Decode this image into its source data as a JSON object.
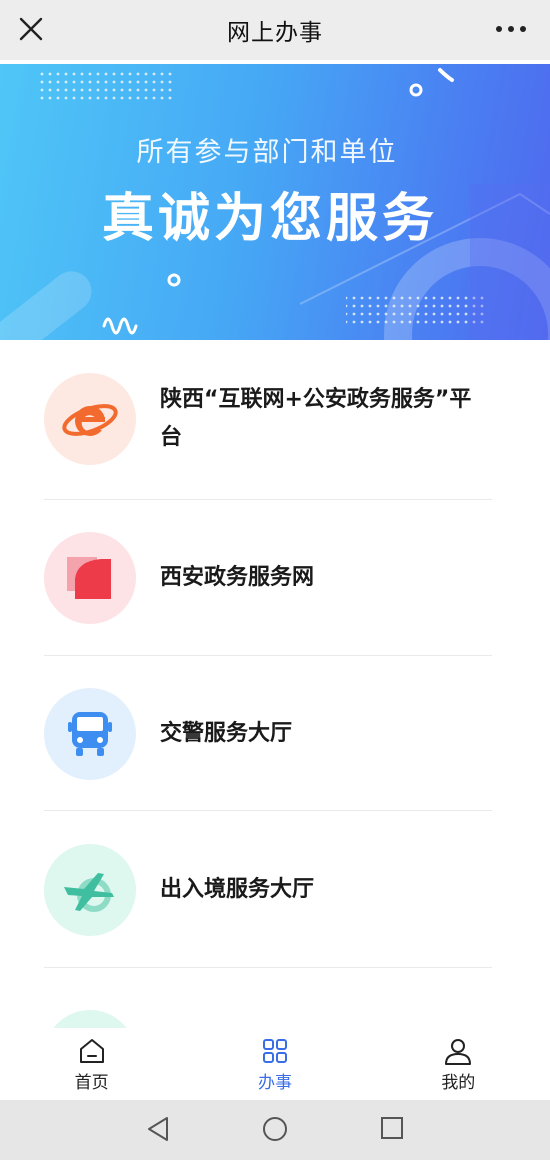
{
  "header": {
    "title": "网上办事",
    "close_icon": "close-icon",
    "more_icon": "more-icon"
  },
  "banner": {
    "subtitle": "所有参与部门和单位",
    "headline": "真诚为您服务"
  },
  "services": [
    {
      "label": "陕西“互联网+公安政务服务”平台",
      "icon": "ie-browser-icon",
      "color": "#f26a2e"
    },
    {
      "label": "西安政务服务网",
      "icon": "xian-gov-icon",
      "color": "#ee3b4a"
    },
    {
      "label": "交警服务大厅",
      "icon": "bus-icon",
      "color": "#3d8ef0"
    },
    {
      "label": "出入境服务大厅",
      "icon": "airplane-icon",
      "color": "#3fbfa0"
    }
  ],
  "tabs": [
    {
      "label": "首页",
      "icon": "home-icon"
    },
    {
      "label": "办事",
      "icon": "grid-icon"
    },
    {
      "label": "我的",
      "icon": "user-icon"
    }
  ],
  "active_tab": "办事",
  "accent_color": "#3a6ee6"
}
